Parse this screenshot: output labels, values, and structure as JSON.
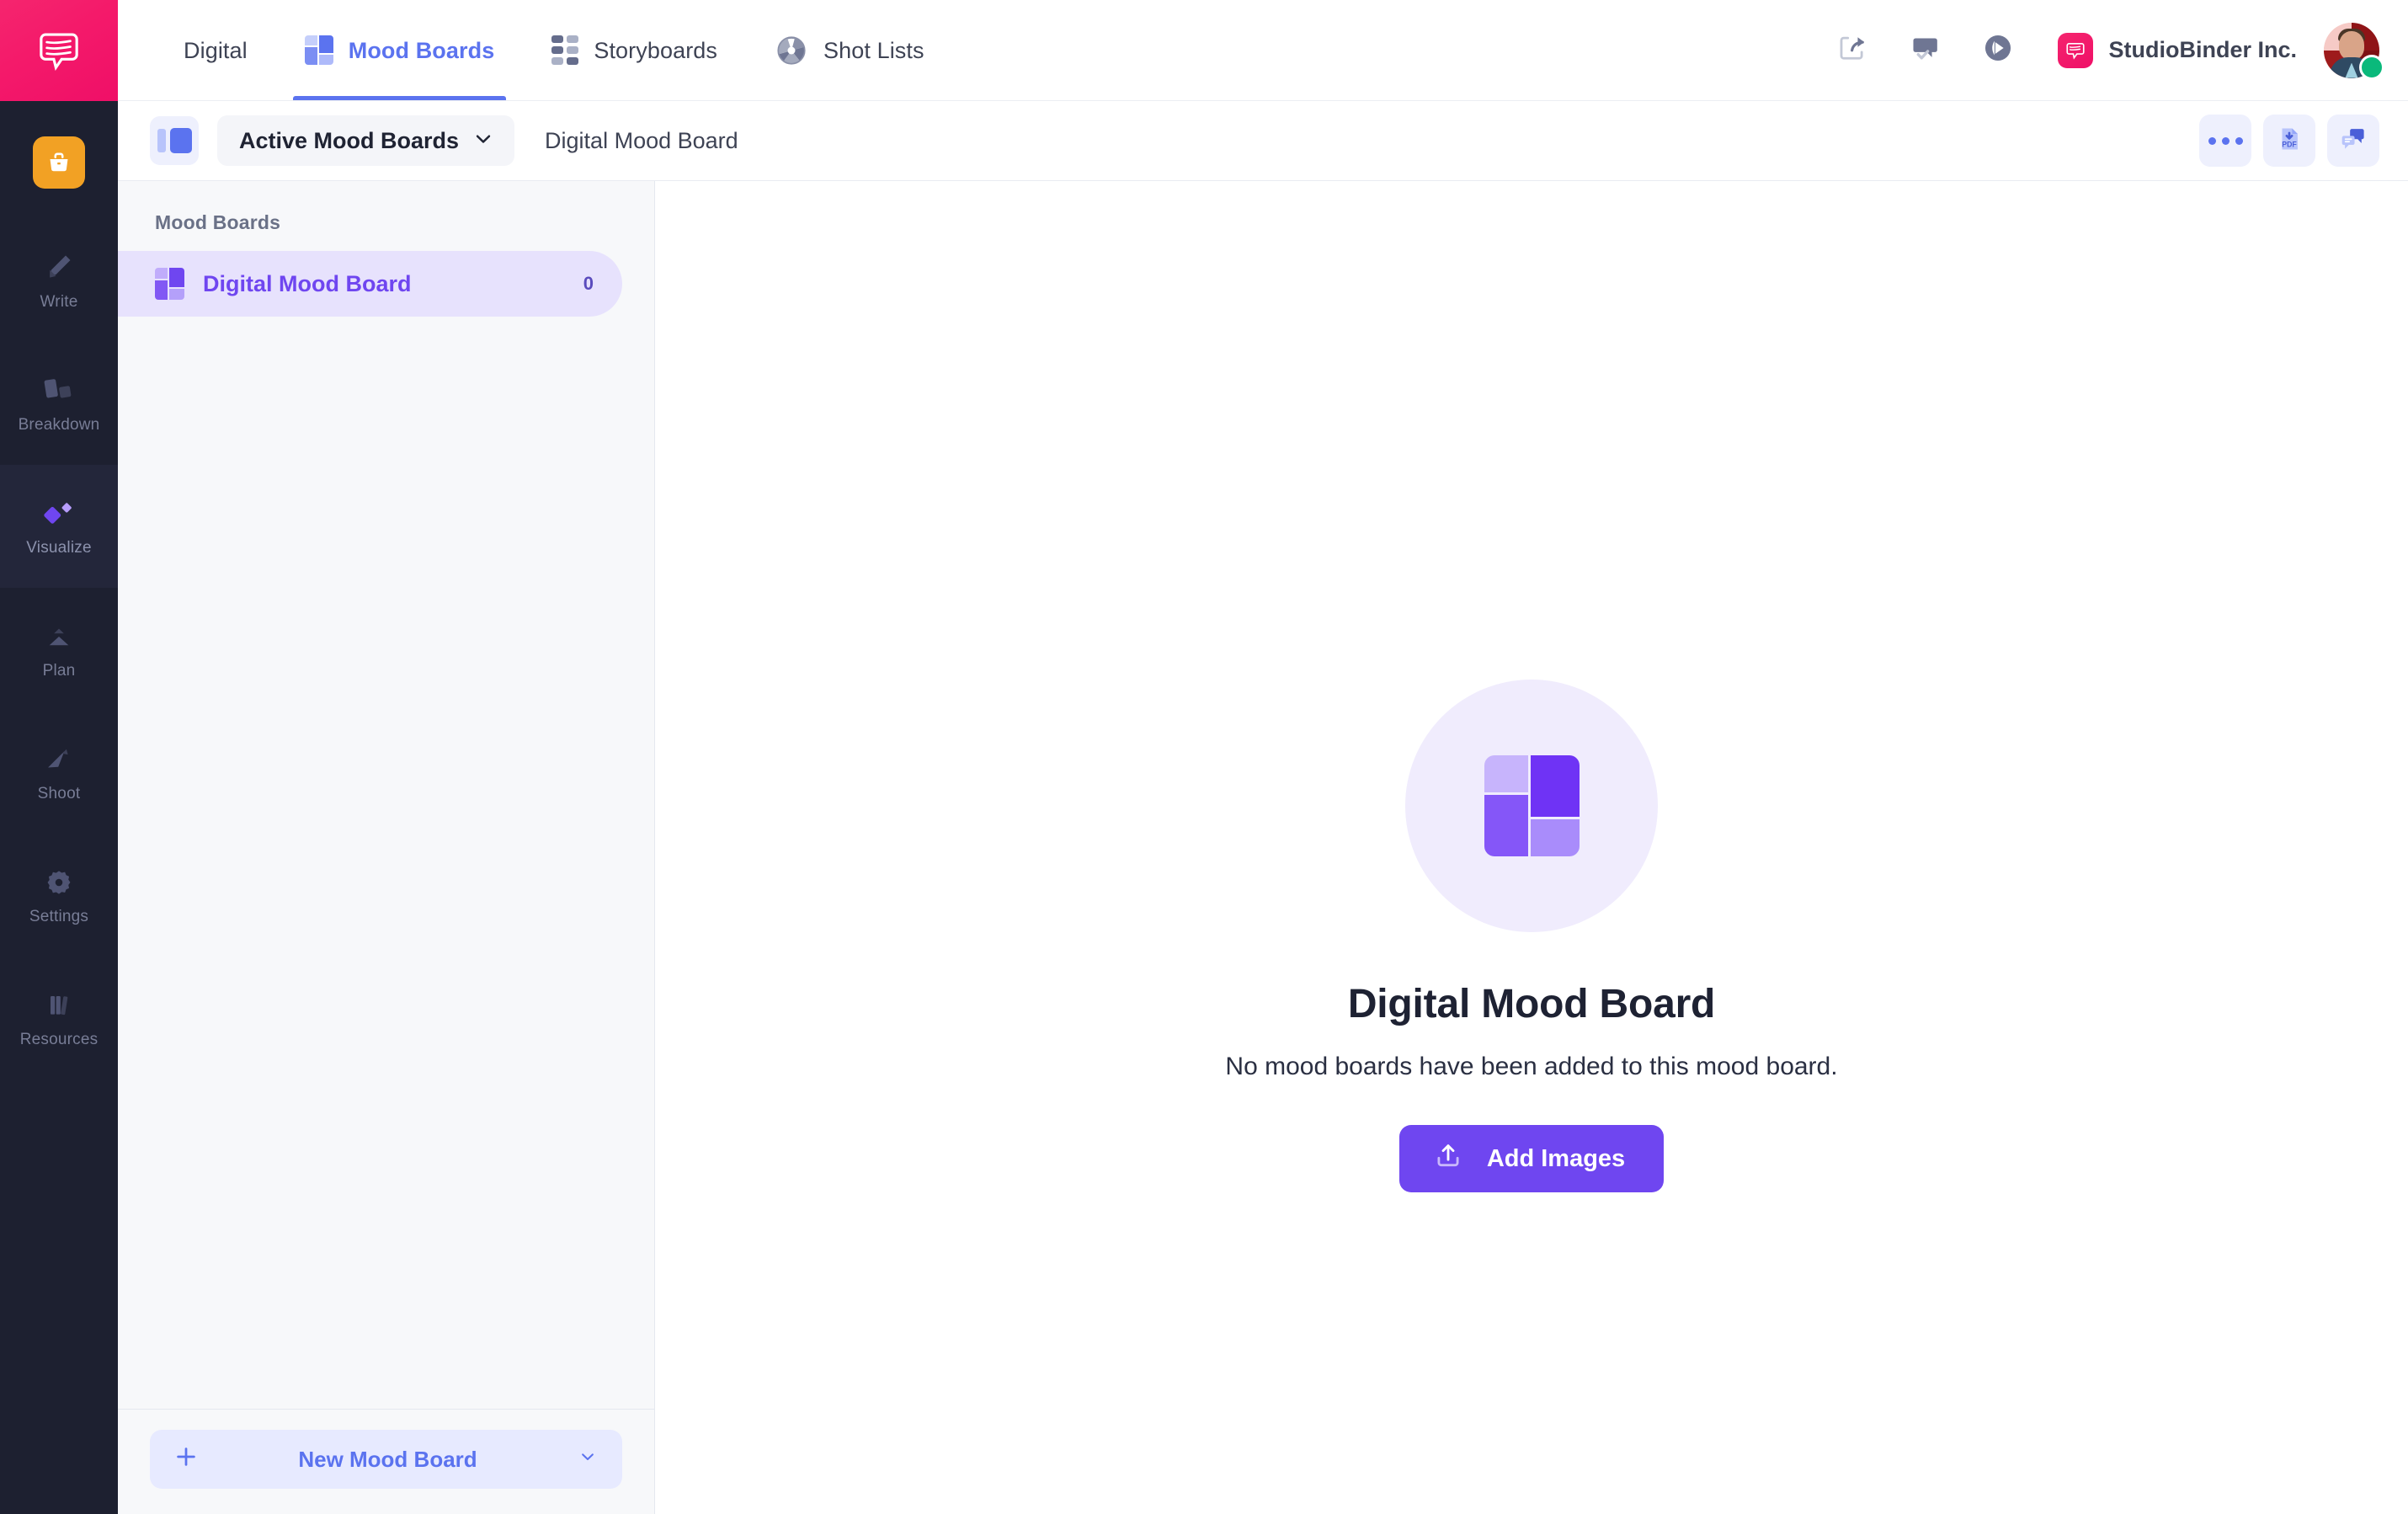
{
  "brand": {
    "logo_icon": "speech-bubble-logo-icon",
    "logo_color": "#f4196a",
    "accent_blue": "#5b73ef",
    "accent_purple": "#6f46f0",
    "rail_bg": "#1d2030"
  },
  "rail": {
    "project_icon": "briefcase-icon",
    "project_icon_color": "#f2a124",
    "items": [
      {
        "label": "Write",
        "icon": "pencil-icon",
        "active": false
      },
      {
        "label": "Breakdown",
        "icon": "cards-icon",
        "active": false
      },
      {
        "label": "Visualize",
        "icon": "diamond-icon",
        "active": true
      },
      {
        "label": "Plan",
        "icon": "mountain-icon",
        "active": false
      },
      {
        "label": "Shoot",
        "icon": "paper-plane-icon",
        "active": false
      },
      {
        "label": "Settings",
        "icon": "gear-icon",
        "active": false
      },
      {
        "label": "Resources",
        "icon": "books-icon",
        "active": false
      }
    ]
  },
  "topbar": {
    "tabs": [
      {
        "label": "Digital",
        "icon": "none",
        "active": false
      },
      {
        "label": "Mood Boards",
        "icon": "mood-board-icon",
        "active": true
      },
      {
        "label": "Storyboards",
        "icon": "grid-icon",
        "active": false
      },
      {
        "label": "Shot Lists",
        "icon": "aperture-icon",
        "active": false
      }
    ],
    "actions": [
      {
        "name": "share-icon"
      },
      {
        "name": "approval-comment-icon"
      },
      {
        "name": "play-icon"
      }
    ],
    "org_name": "StudioBinder Inc.",
    "avatar_name": "user-avatar",
    "status": "online"
  },
  "subbar": {
    "panel_toggle_icon": "sidebar-toggle-icon",
    "filter_label": "Active Mood Boards",
    "filter_caret_icon": "chevron-down-icon",
    "breadcrumb": "Digital Mood Board",
    "actions": [
      {
        "name": "more-options-icon",
        "label": "•••"
      },
      {
        "name": "download-pdf-icon",
        "label": "PDF"
      },
      {
        "name": "comments-icon"
      }
    ]
  },
  "listpanel": {
    "title": "Mood Boards",
    "items": [
      {
        "name": "Digital Mood Board",
        "count": "0",
        "icon": "mood-board-icon",
        "active": true
      }
    ],
    "new_button": {
      "label": "New Mood Board",
      "plus_icon": "plus-icon",
      "caret_icon": "chevron-down-icon"
    }
  },
  "empty_state": {
    "icon": "mood-board-icon",
    "title": "Digital Mood Board",
    "subtitle": "No mood boards have been added to this mood board.",
    "button_label": "Add Images",
    "button_icon": "upload-icon"
  }
}
